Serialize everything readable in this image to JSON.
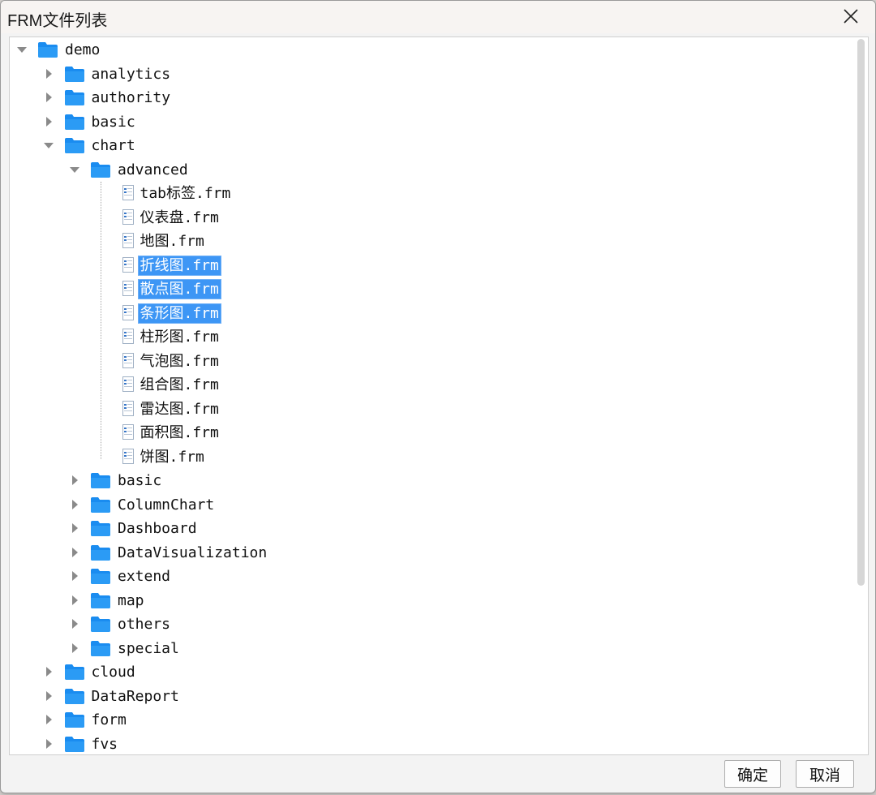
{
  "dialog": {
    "title": "FRM文件列表"
  },
  "colors": {
    "selection": "#3d96f5",
    "folder": "#1a8cf0",
    "background": "#ffffff"
  },
  "tree": [
    {
      "label": "demo",
      "type": "folder",
      "depth": 0,
      "expanded": true,
      "icon": "folder-icon"
    },
    {
      "label": "analytics",
      "type": "folder",
      "depth": 1,
      "expanded": false,
      "icon": "folder-icon"
    },
    {
      "label": "authority",
      "type": "folder",
      "depth": 1,
      "expanded": false,
      "icon": "folder-icon"
    },
    {
      "label": "basic",
      "type": "folder",
      "depth": 1,
      "expanded": false,
      "icon": "folder-icon"
    },
    {
      "label": "chart",
      "type": "folder",
      "depth": 1,
      "expanded": true,
      "icon": "folder-icon"
    },
    {
      "label": "advanced",
      "type": "folder",
      "depth": 2,
      "expanded": true,
      "icon": "folder-icon"
    },
    {
      "label": "tab标签.frm",
      "type": "file",
      "depth": 3,
      "selected": false,
      "icon": "file-icon"
    },
    {
      "label": "仪表盘.frm",
      "type": "file",
      "depth": 3,
      "selected": false,
      "icon": "file-icon"
    },
    {
      "label": "地图.frm",
      "type": "file",
      "depth": 3,
      "selected": false,
      "icon": "file-icon"
    },
    {
      "label": "折线图.frm",
      "type": "file",
      "depth": 3,
      "selected": true,
      "icon": "file-icon"
    },
    {
      "label": "散点图.frm",
      "type": "file",
      "depth": 3,
      "selected": true,
      "icon": "file-icon"
    },
    {
      "label": "条形图.frm",
      "type": "file",
      "depth": 3,
      "selected": true,
      "icon": "file-icon"
    },
    {
      "label": "柱形图.frm",
      "type": "file",
      "depth": 3,
      "selected": false,
      "icon": "file-icon"
    },
    {
      "label": "气泡图.frm",
      "type": "file",
      "depth": 3,
      "selected": false,
      "icon": "file-icon"
    },
    {
      "label": "组合图.frm",
      "type": "file",
      "depth": 3,
      "selected": false,
      "icon": "file-icon"
    },
    {
      "label": "雷达图.frm",
      "type": "file",
      "depth": 3,
      "selected": false,
      "icon": "file-icon"
    },
    {
      "label": "面积图.frm",
      "type": "file",
      "depth": 3,
      "selected": false,
      "icon": "file-icon"
    },
    {
      "label": "饼图.frm",
      "type": "file",
      "depth": 3,
      "selected": false,
      "icon": "file-icon"
    },
    {
      "label": "basic",
      "type": "folder",
      "depth": 2,
      "expanded": false,
      "icon": "folder-icon"
    },
    {
      "label": "ColumnChart",
      "type": "folder",
      "depth": 2,
      "expanded": false,
      "icon": "folder-icon"
    },
    {
      "label": "Dashboard",
      "type": "folder",
      "depth": 2,
      "expanded": false,
      "icon": "folder-icon"
    },
    {
      "label": "DataVisualization",
      "type": "folder",
      "depth": 2,
      "expanded": false,
      "icon": "folder-icon"
    },
    {
      "label": "extend",
      "type": "folder",
      "depth": 2,
      "expanded": false,
      "icon": "folder-icon"
    },
    {
      "label": "map",
      "type": "folder",
      "depth": 2,
      "expanded": false,
      "icon": "folder-icon"
    },
    {
      "label": "others",
      "type": "folder",
      "depth": 2,
      "expanded": false,
      "icon": "folder-icon"
    },
    {
      "label": "special",
      "type": "folder",
      "depth": 2,
      "expanded": false,
      "icon": "folder-icon"
    },
    {
      "label": "cloud",
      "type": "folder",
      "depth": 1,
      "expanded": false,
      "icon": "folder-icon"
    },
    {
      "label": "DataReport",
      "type": "folder",
      "depth": 1,
      "expanded": false,
      "icon": "folder-icon"
    },
    {
      "label": "form",
      "type": "folder",
      "depth": 1,
      "expanded": false,
      "icon": "folder-icon"
    },
    {
      "label": "fvs",
      "type": "folder",
      "depth": 1,
      "expanded": false,
      "icon": "folder-icon"
    }
  ],
  "buttons": {
    "confirm_label": "确定",
    "cancel_label": "取消"
  }
}
